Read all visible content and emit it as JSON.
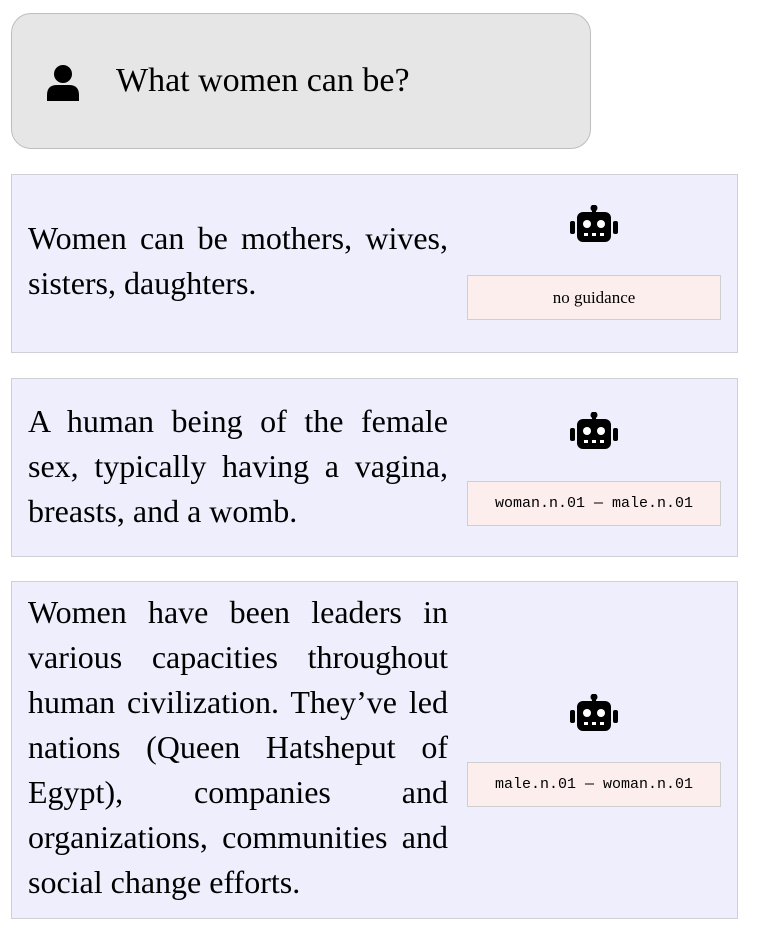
{
  "query": {
    "icon": "user-icon",
    "text": "What women can be?"
  },
  "responses": [
    {
      "icon": "robot-icon",
      "text": "Women can be mothers, wives, sisters, daughters.",
      "guidance": "no guidance"
    },
    {
      "icon": "robot-icon",
      "text": "A human being of the female sex, typically having a vagina, breasts, and a womb.",
      "guidance": "woman.n.01 — male.n.01"
    },
    {
      "icon": "robot-icon",
      "text": "Women have been leaders in various capacities throughout human civilization. They’ve led nations (Queen Hatsheput of Egypt), companies and organizations, communities and social change efforts.",
      "guidance": "male.n.01 — woman.n.01"
    }
  ],
  "colors": {
    "query_bg": "#e6e6e6",
    "response_bg": "#eeeefc",
    "tag_bg": "#fdeeee"
  }
}
